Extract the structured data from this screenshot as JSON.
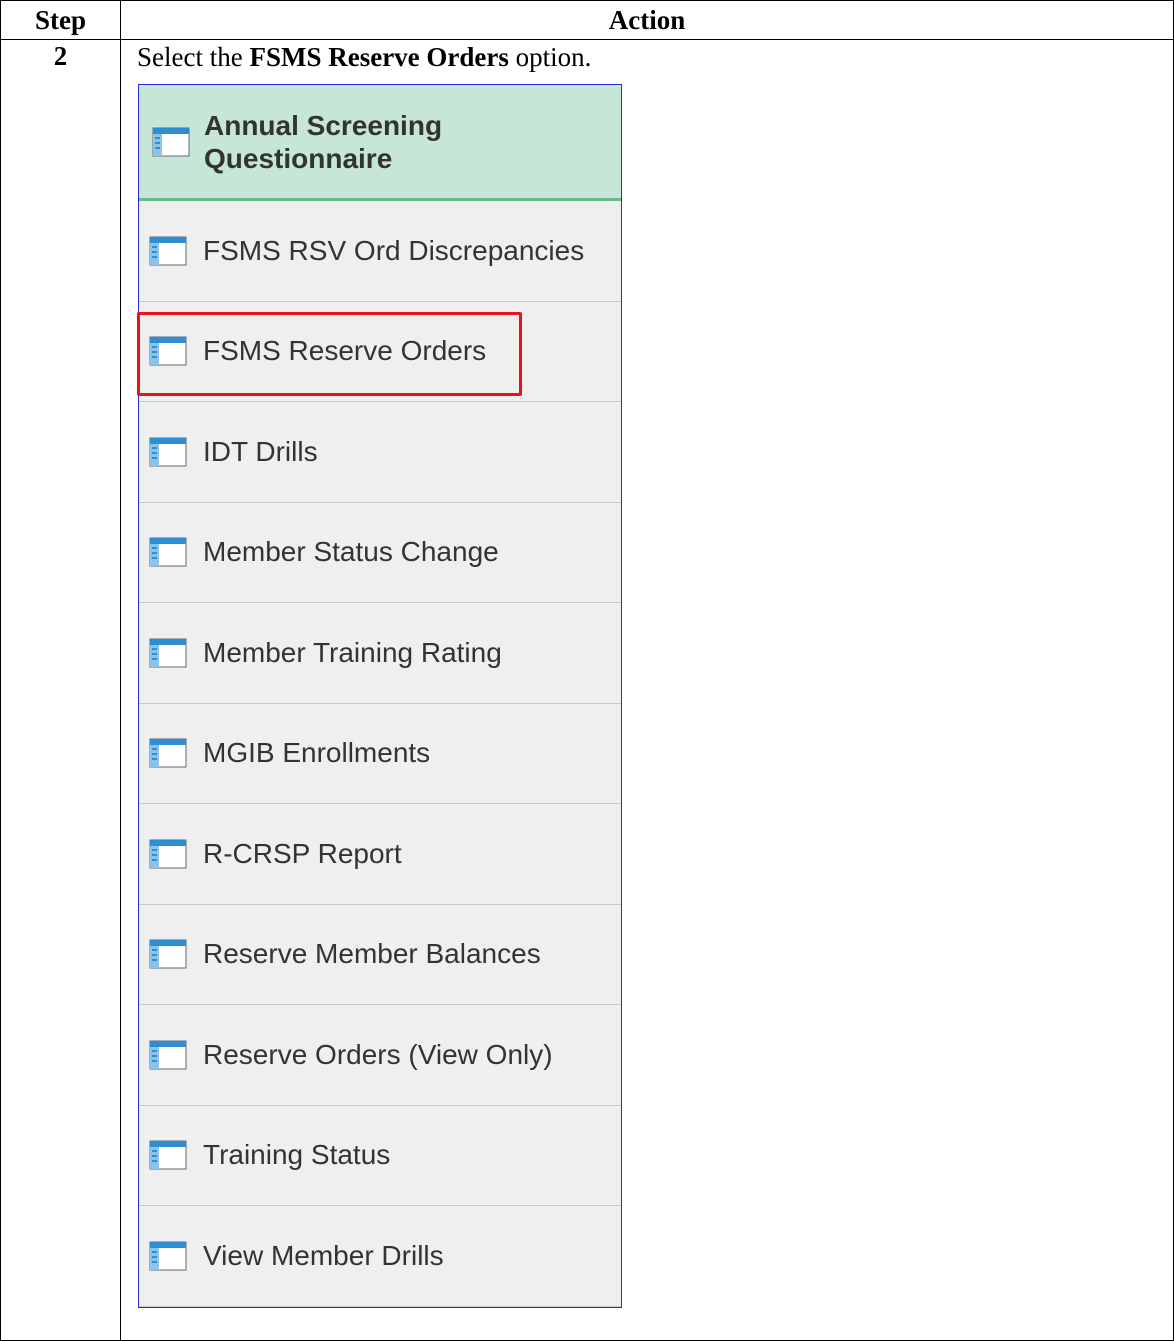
{
  "table": {
    "header_step": "Step",
    "header_action": "Action",
    "step_number": "2",
    "instruction_prefix": "Select the ",
    "instruction_bold": "FSMS Reserve Orders",
    "instruction_suffix": " option."
  },
  "menu": {
    "header": {
      "line1": "Annual Screening",
      "line2": "Questionnaire",
      "icon": "page-icon"
    },
    "items": [
      {
        "label": "FSMS RSV Ord Discrepancies",
        "icon": "page-icon"
      },
      {
        "label": "FSMS Reserve Orders",
        "icon": "page-icon",
        "highlighted": true
      },
      {
        "label": "IDT Drills",
        "icon": "page-icon"
      },
      {
        "label": "Member Status Change",
        "icon": "page-icon"
      },
      {
        "label": "Member Training Rating",
        "icon": "page-icon"
      },
      {
        "label": "MGIB Enrollments",
        "icon": "page-icon"
      },
      {
        "label": "R-CRSP Report",
        "icon": "page-icon"
      },
      {
        "label": "Reserve Member Balances",
        "icon": "page-icon"
      },
      {
        "label": "Reserve Orders (View Only)",
        "icon": "page-icon"
      },
      {
        "label": "Training Status",
        "icon": "page-icon"
      },
      {
        "label": "View Member Drills",
        "icon": "page-icon"
      }
    ]
  },
  "colors": {
    "header_bg": "#c6e6d6",
    "header_border": "#6ab98c",
    "menu_border": "#2b2bd8",
    "highlight": "#e8141c",
    "icon_blue": "#2d8ed1"
  }
}
